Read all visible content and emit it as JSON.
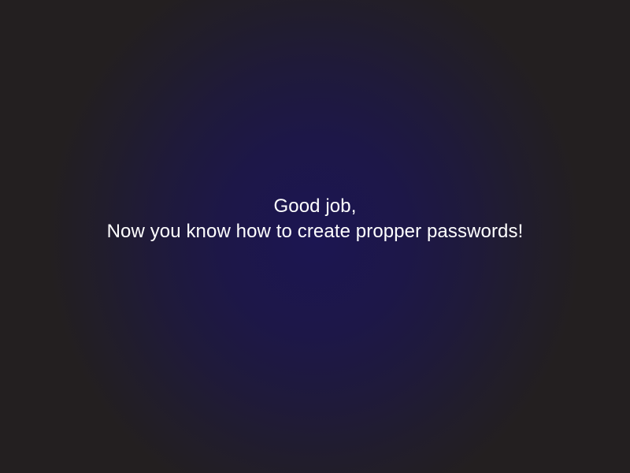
{
  "message": {
    "line1": "Good job,",
    "line2": "Now you know how to create propper passwords!"
  },
  "colors": {
    "background": "#231f20",
    "glow_center": "#1c1652",
    "text": "#ffffff"
  }
}
